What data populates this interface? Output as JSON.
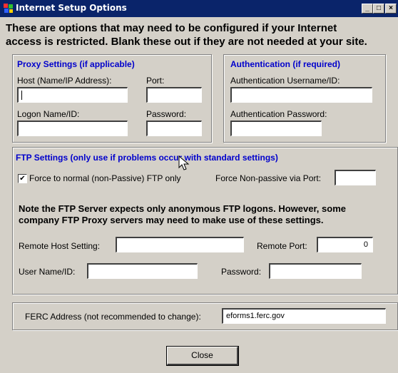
{
  "window": {
    "title": "Internet Setup Options",
    "minimize": "_",
    "maximize": "□",
    "close": "×"
  },
  "heading": {
    "line1": "These are options that may need to be configured if your Internet",
    "line2": "access is restricted. Blank these out if they are not needed at your site."
  },
  "proxy": {
    "title": "Proxy Settings (if applicable)",
    "host_label": "Host (Name/IP Address):",
    "host_value": "",
    "port_label": "Port:",
    "port_value": "",
    "logon_label": "Logon Name/ID:",
    "logon_value": "",
    "password_label": "Password:",
    "password_value": ""
  },
  "auth": {
    "title": "Authentication (if required)",
    "username_label": "Authentication Username/ID:",
    "username_value": "",
    "password_label": "Authentication Password:",
    "password_value": ""
  },
  "ftp": {
    "title": "FTP Settings (only use if problems occur with standard settings)",
    "force_label": "Force to normal (non-Passive) FTP only",
    "force_checked": true,
    "nonpassive_label": "Force Non-passive via Port:",
    "nonpassive_value": "",
    "note_line1": "Note the FTP Server expects only anonymous FTP logons. However, some",
    "note_line2": "company FTP Proxy servers may need to make use of these settings.",
    "remote_host_label": "Remote Host Setting:",
    "remote_host_value": "",
    "remote_port_label": "Remote Port:",
    "remote_port_value": "0",
    "user_label": "User Name/ID:",
    "user_value": "",
    "password_label": "Password:",
    "password_value": ""
  },
  "ferc": {
    "label": "FERC Address (not recommended to change):",
    "value": "eforms1.ferc.gov"
  },
  "close_button": "Close"
}
